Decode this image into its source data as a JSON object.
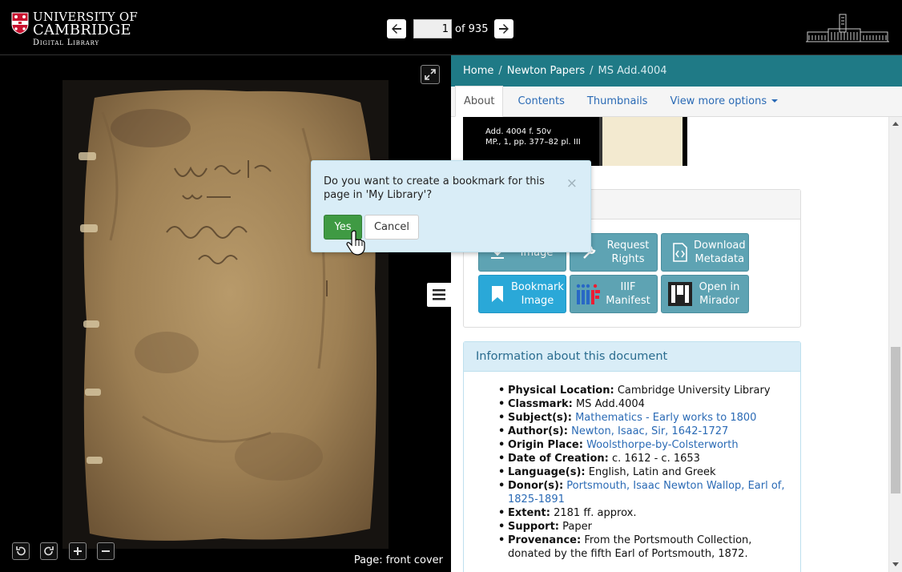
{
  "header": {
    "logo": {
      "line1": "UNIVERSITY OF",
      "line2": "CAMBRIDGE",
      "line3": "Digital Library"
    },
    "pager": {
      "page_value": "1",
      "of_text": "of 935"
    },
    "icons": {
      "prev": "arrow-left-icon",
      "next": "arrow-right-icon",
      "library": "library-building-icon"
    }
  },
  "viewer": {
    "page_label": "Page: front cover",
    "controls": [
      "rotate-left-icon",
      "rotate-right-icon",
      "zoom-in-icon",
      "zoom-out-icon"
    ]
  },
  "breadcrumb": {
    "home": "Home",
    "collection": "Newton Papers",
    "current": "MS Add.4004",
    "separator": "/"
  },
  "tabs": {
    "about": "About",
    "contents": "Contents",
    "thumbnails": "Thumbnails",
    "more": "View more options"
  },
  "thumbnail": {
    "caption_line1": "Add. 4004 f. 50v",
    "caption_line2": "MP., 1, pp. 377–82 pl. III"
  },
  "tools": {
    "download_image": "Image",
    "request_rights": "Request Rights",
    "download_metadata": "Download Metadata",
    "bookmark_image": "Bookmark Image",
    "iiif_manifest": "IIIF Manifest",
    "open_mirador": "Open in Mirador"
  },
  "info": {
    "title": "Information about this document",
    "physical_location_label": "Physical Location:",
    "physical_location": "Cambridge University Library",
    "classmark_label": "Classmark:",
    "classmark": "MS Add.4004",
    "subjects_label": "Subject(s):",
    "subjects": "Mathematics - Early works to 1800",
    "authors_label": "Author(s):",
    "authors": "Newton, Isaac, Sir, 1642-1727",
    "origin_label": "Origin Place:",
    "origin": "Woolsthorpe-by-Colsterworth",
    "date_label": "Date of Creation:",
    "date": "c. 1612 - c. 1653",
    "languages_label": "Language(s):",
    "languages": "English, Latin and Greek",
    "donors_label": "Donor(s):",
    "donors": "Portsmouth, Isaac Newton Wallop, Earl of, 1825-1891",
    "extent_label": "Extent:",
    "extent": "2181 ff. approx.",
    "support_label": "Support:",
    "support": "Paper",
    "provenance_label": "Provenance:",
    "provenance": "From the Portsmouth Collection, donated by the fifth Earl of Portsmouth, 1872."
  },
  "popover": {
    "message": "Do you want to create a bookmark for this page in 'My Library'?",
    "close": "×",
    "yes": "Yes",
    "cancel": "Cancel"
  },
  "colors": {
    "breadcrumb_bg": "#1f7a86",
    "link": "#2a6ab5",
    "info_bg": "#d9edf7",
    "yes_button": "#3f9a43",
    "tool_button": "#5ea3b3",
    "bookmark_button": "#2aa8d8"
  }
}
